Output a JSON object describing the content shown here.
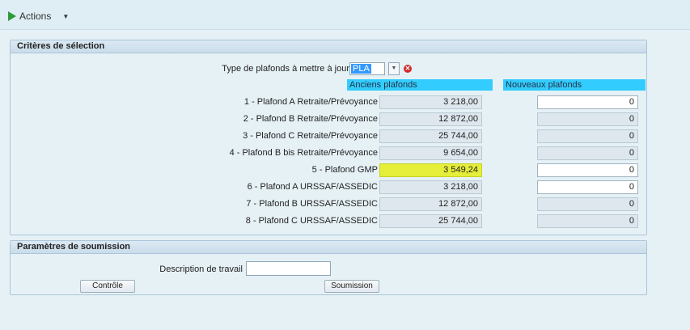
{
  "toolbar": {
    "actions_label": "Actions"
  },
  "criteria": {
    "title": "Critères de sélection",
    "type_label": "Type de plafonds à mettre à jour",
    "type_value": "PLA",
    "old_header": "Anciens plafonds",
    "new_header": "Nouveaux plafonds",
    "rows": [
      {
        "label": "1 - Plafond A Retraite/Prévoyance",
        "old": "3 218,00",
        "new": "0",
        "editable": true
      },
      {
        "label": "2 - Plafond B Retraite/Prévoyance",
        "old": "12 872,00",
        "new": "0",
        "editable": false
      },
      {
        "label": "3 - Plafond C Retraite/Prévoyance",
        "old": "25 744,00",
        "new": "0",
        "editable": false
      },
      {
        "label": "4 - Plafond B bis Retraite/Prévoyance",
        "old": "9 654,00",
        "new": "0",
        "editable": false
      },
      {
        "label": "5 - Plafond GMP",
        "old": "3 549,24",
        "new": "0",
        "editable": true,
        "highlight": true
      },
      {
        "label": "6 - Plafond A URSSAF/ASSEDIC",
        "old": "3 218,00",
        "new": "0",
        "editable": true
      },
      {
        "label": "7 - Plafond B URSSAF/ASSEDIC",
        "old": "12 872,00",
        "new": "0",
        "editable": false
      },
      {
        "label": "8 - Plafond C URSSAF/ASSEDIC",
        "old": "25 744,00",
        "new": "0",
        "editable": false
      }
    ]
  },
  "submission": {
    "title": "Paramètres de soumission",
    "desc_label": "Description de travail",
    "desc_value": "",
    "control_button": "Contrôle",
    "submit_button": "Soumission"
  }
}
